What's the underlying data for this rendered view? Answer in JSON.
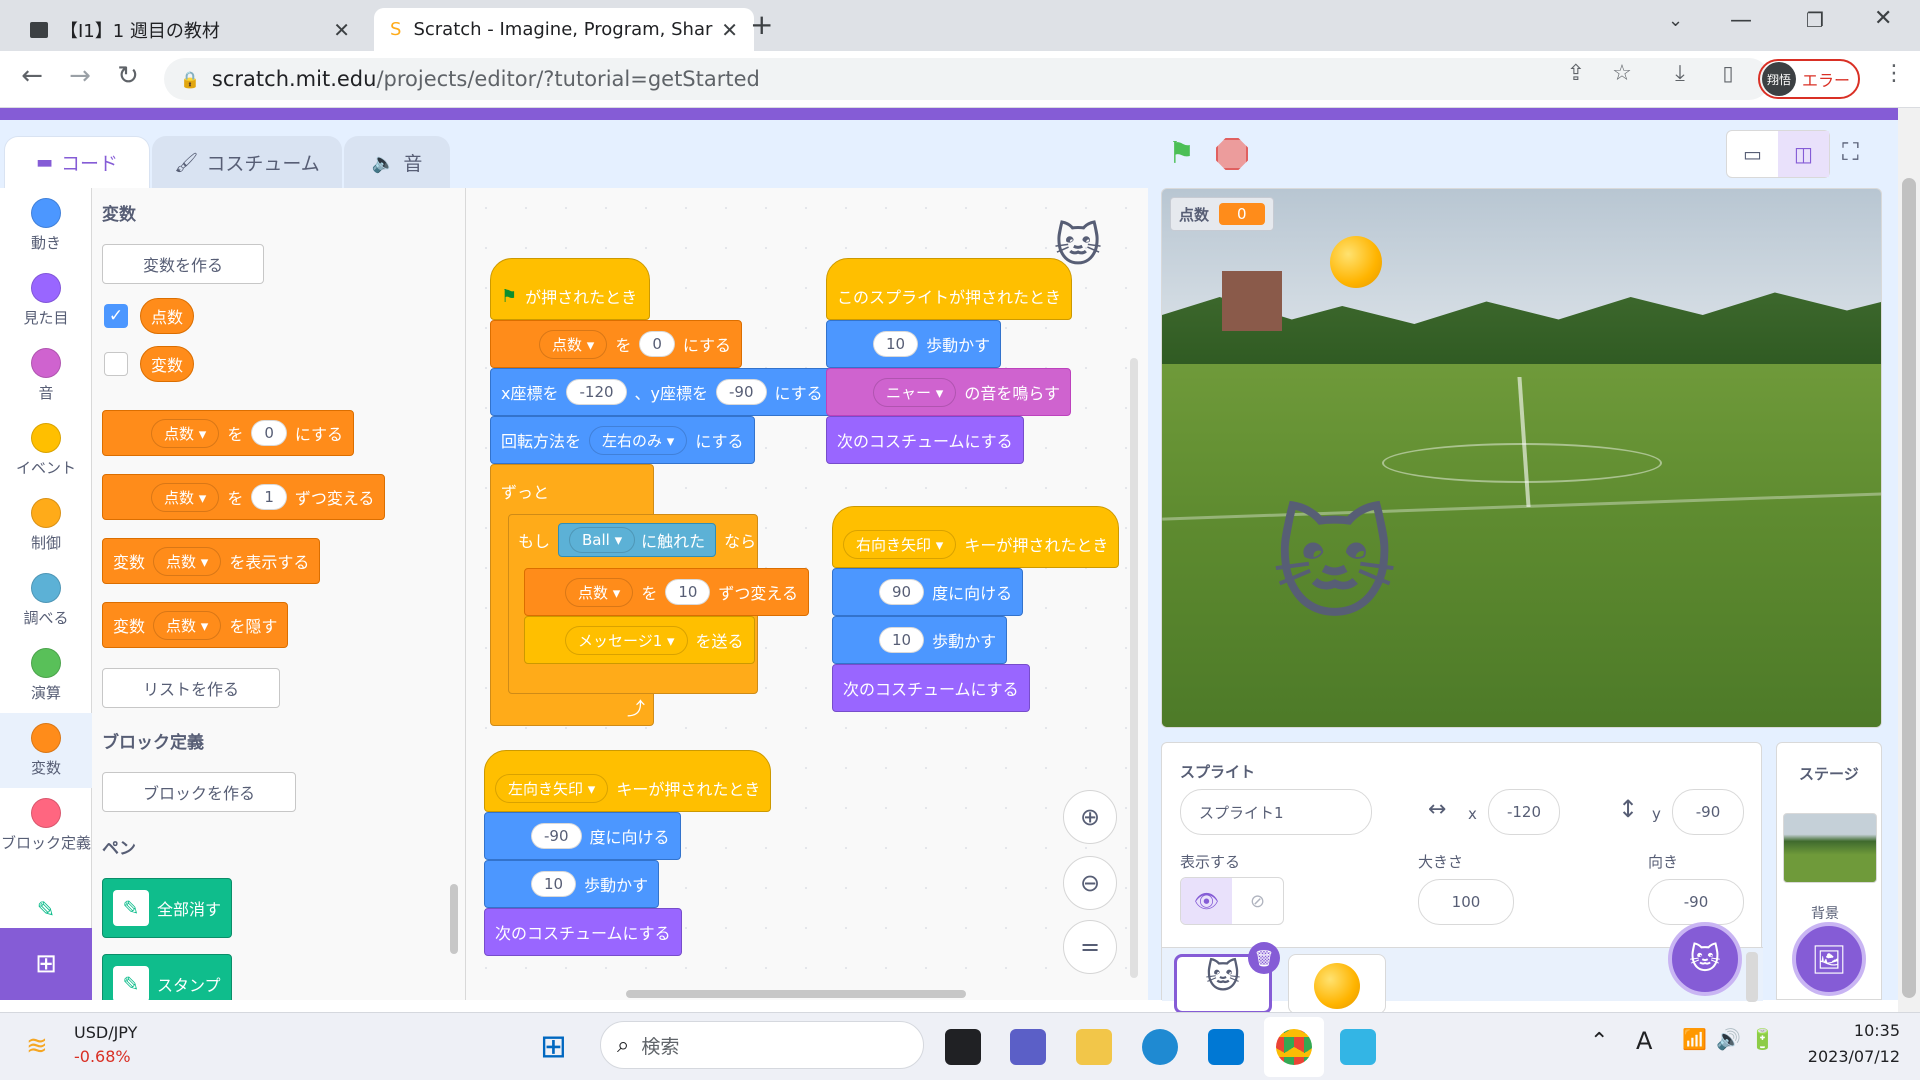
{
  "browser": {
    "tabs": [
      {
        "title": "【I1】1 週目の教材"
      },
      {
        "title": "Scratch - Imagine, Program, Shar"
      }
    ],
    "new_tab": "+",
    "url_domain": "scratch.mit.edu",
    "url_path": "/projects/editor/?tutorial=getStarted",
    "profile_initial": "翔悟",
    "profile_status": "エラー"
  },
  "editor": {
    "tabs": {
      "code": "コード",
      "costumes": "コスチューム",
      "sounds": "音"
    },
    "categories": [
      "動き",
      "見た目",
      "音",
      "イベント",
      "制御",
      "調べる",
      "演算",
      "変数",
      "ブロック定義"
    ],
    "category_colors": [
      "#4c97ff",
      "#9966ff",
      "#cf63cf",
      "#ffbf00",
      "#ffab19",
      "#5cb1d6",
      "#59c059",
      "#ff8c1a",
      "#ff6680"
    ]
  },
  "flyout": {
    "heading_variables": "変数",
    "make_variable": "変数を作る",
    "var1": "点数",
    "var2": "変数",
    "set_block": {
      "var": "点数",
      "to": "を",
      "value": "0",
      "suffix": "にする"
    },
    "change_block": {
      "var": "点数",
      "to": "を",
      "value": "1",
      "suffix": "ずつ変える"
    },
    "show_block": {
      "prefix": "変数",
      "var": "点数",
      "suffix": "を表示する"
    },
    "hide_block": {
      "prefix": "変数",
      "var": "点数",
      "suffix": "を隠す"
    },
    "make_list": "リストを作る",
    "heading_myblocks": "ブロック定義",
    "make_block": "ブロックを作る",
    "heading_pen": "ペン",
    "pen_clear": "全部消す",
    "pen_stamp": "スタンプ"
  },
  "script1": {
    "hat": "が押されたとき",
    "set_var": "点数",
    "set_wo": "を",
    "set_val": "0",
    "set_suffix": "にする",
    "goto_x_label": "x座標を",
    "goto_x": "-120",
    "goto_y_label": "、y座標を",
    "goto_y": "-90",
    "goto_suffix": "にする",
    "rot_label": "回転方法を",
    "rot_val": "左右のみ",
    "rot_suffix": "にする",
    "forever": "ずっと",
    "if_label": "もし",
    "if_sensor": "Ball",
    "if_touch": "に触れた",
    "if_then": "なら",
    "chg_var": "点数",
    "chg_wo": "を",
    "chg_val": "10",
    "chg_suffix": "ずつ変える",
    "bcast_val": "メッセージ1",
    "bcast_suffix": "を送る"
  },
  "script2": {
    "hat": "このスプライトが押されたとき",
    "move_val": "10",
    "move_label": "歩動かす",
    "sound_val": "ニャー",
    "sound_suffix": "の音を鳴らす",
    "next_costume": "次のコスチュームにする"
  },
  "script3": {
    "key": "右向き矢印",
    "hat_suffix": "キーが押されたとき",
    "dir_val": "90",
    "dir_label": "度に向ける",
    "move_val": "10",
    "move_label": "歩動かす",
    "next_costume": "次のコスチュームにする"
  },
  "script4": {
    "key": "左向き矢印",
    "hat_suffix": "キーが押されたとき",
    "dir_val": "-90",
    "dir_label": "度に向ける",
    "move_val": "10",
    "move_label": "歩動かす",
    "next_costume": "次のコスチュームにする"
  },
  "stage": {
    "monitor_label": "点数",
    "monitor_value": "0"
  },
  "sprite_info": {
    "title": "スプライト",
    "name": "スプライト1",
    "x_label": "x",
    "x": "-120",
    "y_label": "y",
    "y": "-90",
    "show_label": "表示する",
    "size_label": "大きさ",
    "size": "100",
    "dir_label": "向き",
    "dir": "-90"
  },
  "stage_panel": {
    "title": "ステージ",
    "backdrop_label": "背景"
  },
  "taskbar": {
    "ticker": "USD/JPY",
    "change": "-0.68%",
    "search_placeholder": "検索",
    "time": "10:35",
    "date": "2023/07/12",
    "ime": "A"
  }
}
